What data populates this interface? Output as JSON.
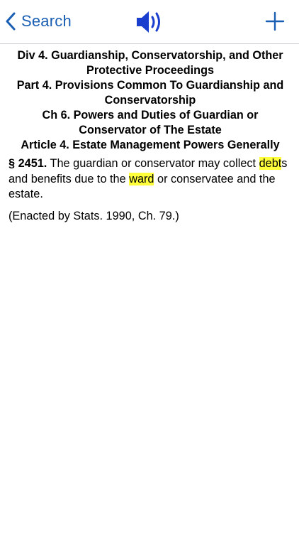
{
  "nav": {
    "back_label": "Search",
    "back_icon": "chevron-left-icon",
    "speaker_icon": "speaker-icon",
    "add_icon": "plus-icon",
    "accent_color": "#1a5fb4",
    "speaker_color": "#1a3fcf"
  },
  "headings": [
    "Div 4. Guardianship, Conservatorship, and Other Protective Proceedings",
    "Part 4. Provisions Common To Guardianship and Conservatorship",
    "Ch 6. Powers and Duties of Guardian or Conservator of The Estate",
    "Article 4. Estate Management Powers Generally"
  ],
  "section": {
    "number": "§ 2451.",
    "text_1": " The guardian or conservator may collect ",
    "highlight_1": "debt",
    "text_2": "s and benefits due to the ",
    "highlight_2": "ward",
    "text_3": " or conservatee and the estate.",
    "highlight_color": "#ffff3b"
  },
  "history": "(Enacted by Stats. 1990, Ch. 79.)"
}
